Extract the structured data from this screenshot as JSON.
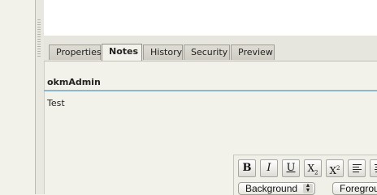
{
  "tabs": [
    {
      "label": "Properties",
      "active": false
    },
    {
      "label": "Notes",
      "active": true
    },
    {
      "label": "History",
      "active": false
    },
    {
      "label": "Security",
      "active": false
    },
    {
      "label": "Preview",
      "active": false
    }
  ],
  "note": {
    "author": "okmAdmin",
    "text": "Test"
  },
  "toolbar": {
    "bold": "B",
    "italic": "I",
    "underline": "U",
    "subscript_base": "X",
    "subscript_mark": "2",
    "superscript_base": "X",
    "superscript_mark": "2",
    "background_select": "Background",
    "foreground_select": "Foregrou"
  },
  "colors": {
    "divider": "#8db6d1",
    "panel": "#f3f2ea"
  }
}
